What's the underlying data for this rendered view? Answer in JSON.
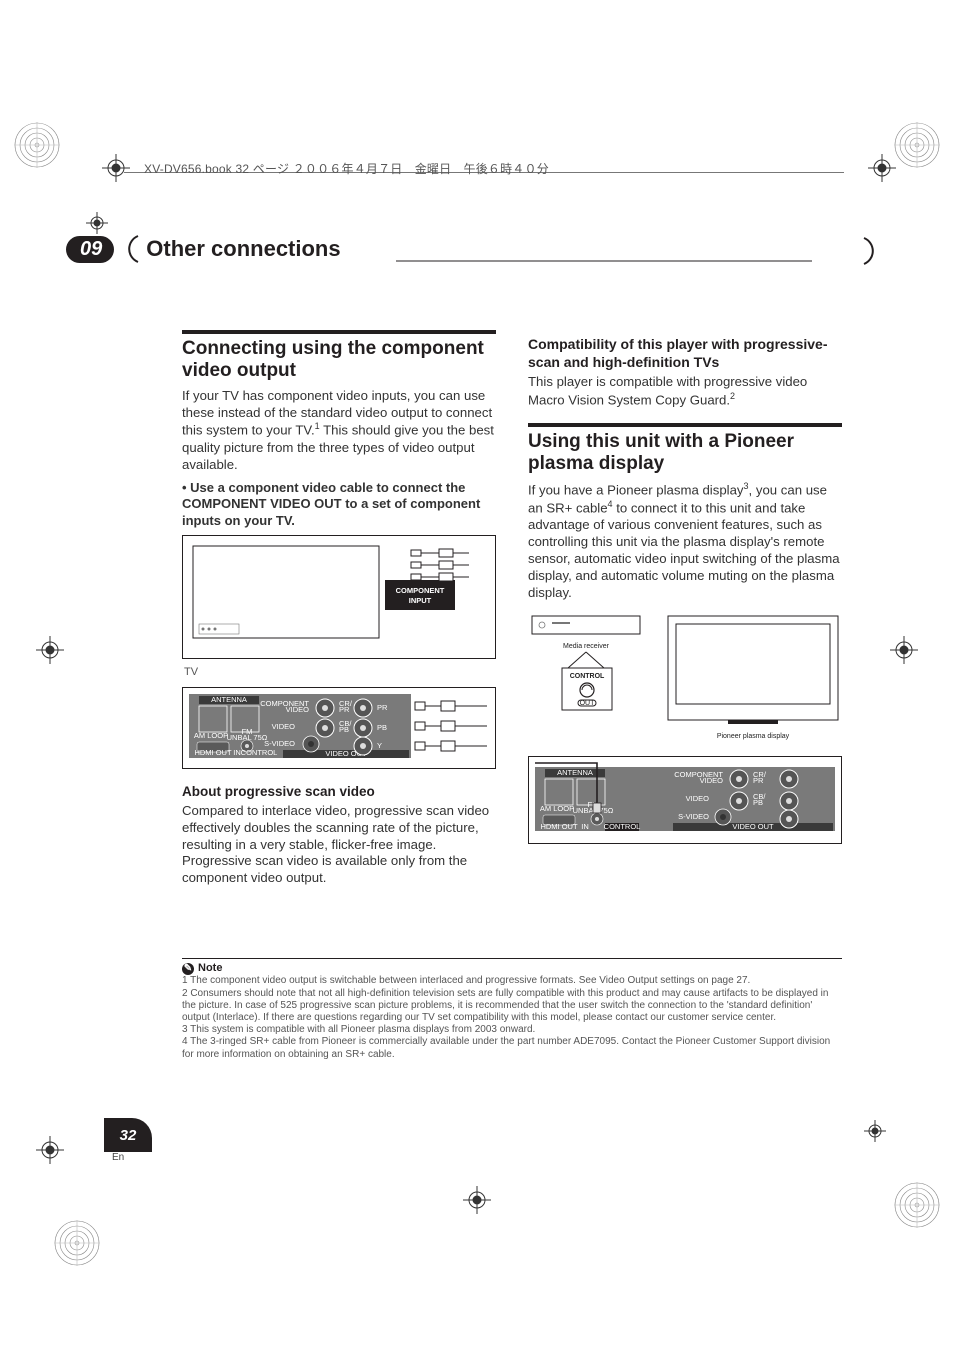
{
  "header": {
    "book_line": "XV-DV656.book  32 ページ  ２００６年４月７日　金曜日　午後６時４０分"
  },
  "section": {
    "number": "09",
    "title": "Other connections"
  },
  "left": {
    "h_connecting": "Connecting using the component video output",
    "p1_a": "If your TV has component video inputs, you can use these instead of the standard video output to connect this system to your TV.",
    "p1_sup": "1",
    "p1_b": " This should give you the best quality picture from the three types of video output available.",
    "bullet": "•   Use a component video cable to connect the COMPONENT VIDEO OUT to a set of component inputs on your TV.",
    "fig_tv_label": "TV",
    "fig_comp_input": "COMPONENT INPUT",
    "h_about": "About progressive scan video",
    "p2": "Compared to interlace video, progressive scan video effectively doubles the scanning rate of the picture, resulting in a very stable, flicker-free image. Progressive scan video is available only from the component video output.",
    "panel": {
      "antenna": "ANTENNA",
      "am_loop": "AM LOOP",
      "fm": "FM UNBAL 75Ω",
      "hdmi_out": "HDMI OUT",
      "in": "IN",
      "control": "CONTROL",
      "component": "COMPONENT VIDEO",
      "video": "VIDEO",
      "svideo": "S-VIDEO",
      "video_out": "VIDEO  OUT",
      "cr": "CR/ PR",
      "cb": "CB/ PB",
      "y": "Y"
    }
  },
  "right": {
    "h_compat": "Compatibility of this player with progressive-scan and high-definition TVs",
    "p_compat_a": "This player is compatible with progressive video Macro Vision System Copy Guard.",
    "p_compat_sup": "2",
    "h_pioneer": "Using this unit with a Pioneer plasma display",
    "p_pioneer_a": "If you have a Pioneer plasma display",
    "p_pioneer_sup3": "3",
    "p_pioneer_b": ", you can use an SR+ cable",
    "p_pioneer_sup4": "4",
    "p_pioneer_c": " to connect it to this unit and take advantage of various convenient features, such as controlling this unit via the plasma display's remote sensor, automatic video input switching of the plasma display, and automatic volume muting on the plasma display.",
    "fig_media": "Media receiver",
    "fig_plasma": "Pioneer plasma display",
    "fig_control": "CONTROL",
    "fig_out": "OUT"
  },
  "notes": {
    "title": "Note",
    "n1": "1 The component video output is switchable between interlaced and progressive formats. See Video Output settings on page 27.",
    "n2": "2 Consumers should note that not all high-definition television sets are fully compatible with this product and may cause artifacts to be displayed in the picture. In case of 525 progressive scan picture problems, it is recommended that the user switch the connection to the 'standard definition' output (Interlace). If there are questions regarding our TV set compatibility with this model, please contact our customer service center.",
    "n3": "3 This system is compatible with all Pioneer plasma displays from 2003 onward.",
    "n4": "4 The 3-ringed SR+ cable from Pioneer is commercially available under the part number ADE7095. Contact the Pioneer Customer Support division for more information on obtaining an SR+ cable."
  },
  "page": {
    "num": "32",
    "lang": "En"
  }
}
